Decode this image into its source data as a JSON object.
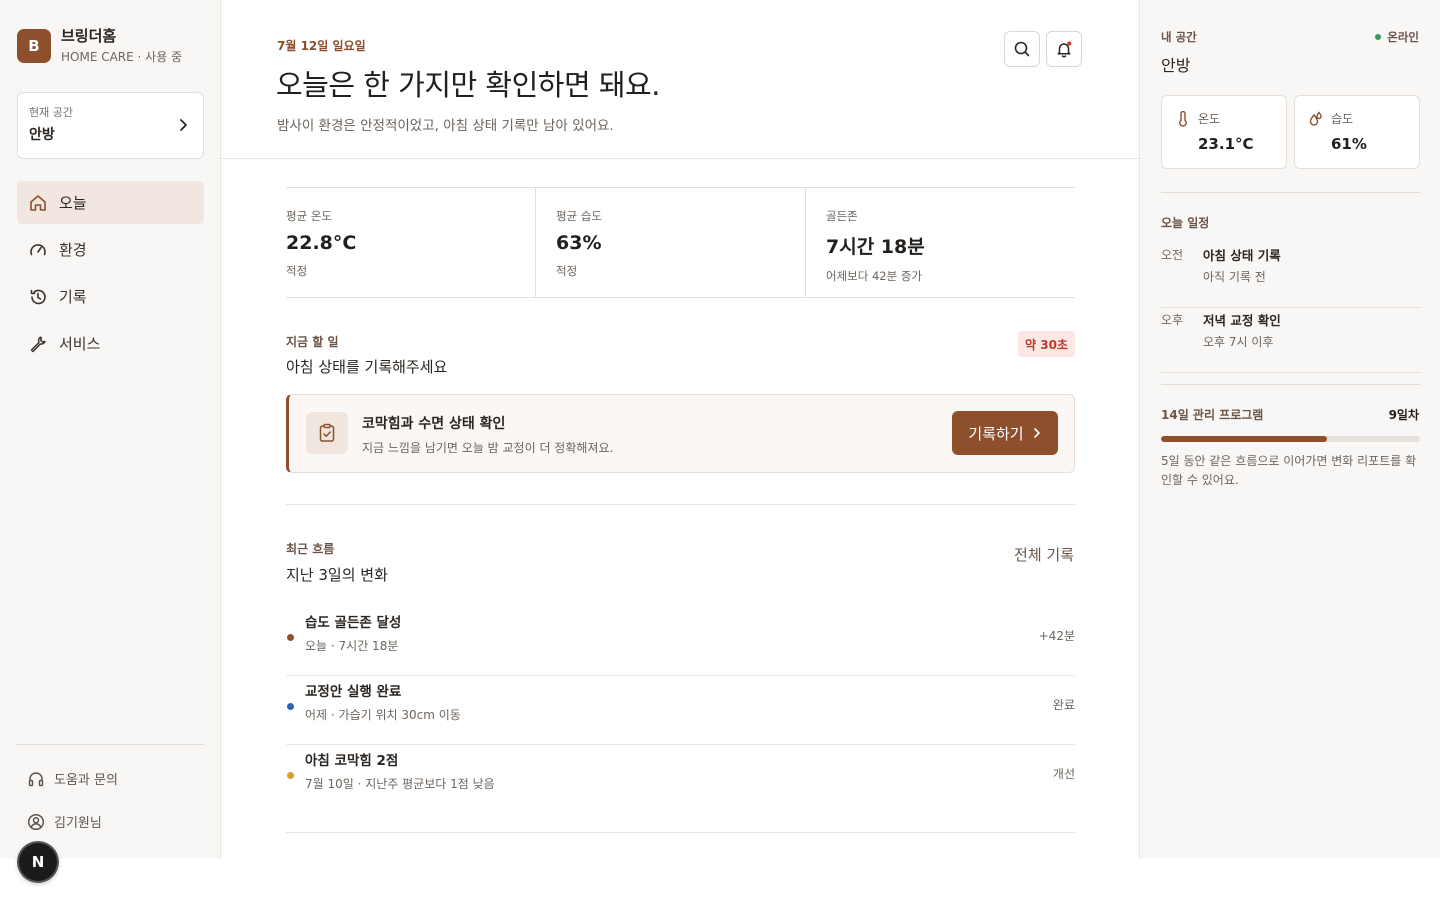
{
  "brand": {
    "logo_letter": "B",
    "name": "브링더홈",
    "subtitle": "HOME CARE · 사용 중"
  },
  "space_selector": {
    "label": "현재 공간",
    "value": "안방"
  },
  "nav": [
    {
      "label": "오늘",
      "icon": "home-icon",
      "active": true
    },
    {
      "label": "환경",
      "icon": "gauge-icon",
      "active": false
    },
    {
      "label": "기록",
      "icon": "history-icon",
      "active": false
    },
    {
      "label": "서비스",
      "icon": "wrench-icon",
      "active": false
    }
  ],
  "sidebar_footer": {
    "help": "도움과 문의",
    "user": "김기원님",
    "badge": "N"
  },
  "header": {
    "date": "7월 12일 일요일",
    "title": "오늘은 한 가지만 확인하면 돼요.",
    "subtitle": "밤사이 환경은 안정적이었고, 아침 상태 기록만 남아 있어요."
  },
  "stats": [
    {
      "label": "평균 온도",
      "value": "22.8°C",
      "note": "적정"
    },
    {
      "label": "평균 습도",
      "value": "63%",
      "note": "적정"
    },
    {
      "label": "골든존",
      "value": "7시간 18분",
      "note": "어제보다 42분 증가"
    }
  ],
  "todo": {
    "eyebrow": "지금 할 일",
    "title": "아침 상태를 기록해주세요",
    "time_chip": "약 30초",
    "card_title": "코막힘과 수면 상태 확인",
    "card_sub": "지금 느낌을 남기면 오늘 밤 교정이 더 정확해져요.",
    "button": "기록하기"
  },
  "recent": {
    "eyebrow": "최근 흐름",
    "title": "지난 3일의 변화",
    "all_link": "전체 기록",
    "items": [
      {
        "title": "습도 골든존 달성",
        "sub": "오늘 · 7시간 18분",
        "right": "+42분",
        "color": "#8d4f2c"
      },
      {
        "title": "교정안 실행 완료",
        "sub": "어제 · 가습기 위치 30cm 이동",
        "right": "완료",
        "color": "#2f5fb8"
      },
      {
        "title": "아침 코막힘 2점",
        "sub": "7월 10일 · 지난주 평균보다 1점 낮음",
        "right": "개선",
        "color": "#d9a22c"
      }
    ]
  },
  "right_panel": {
    "eyebrow": "내 공간",
    "online": "온라인",
    "room": "안방",
    "temp_label": "온도",
    "temp_value": "23.1°C",
    "humid_label": "습도",
    "humid_value": "61%",
    "schedule_title": "오늘 일정",
    "schedule": [
      {
        "when": "오전",
        "what": "아침 상태 기록",
        "status": "아직 기록 전"
      },
      {
        "when": "오후",
        "what": "저녁 교정 확인",
        "status": "오후 7시 이후"
      }
    ],
    "program_title": "14일 관리 프로그램",
    "program_day": "9일차",
    "program_progress": 0.64,
    "program_note": "5일 동안 같은 흐름으로 이어가면 변화 리포트를 확인할 수 있어요."
  },
  "colors": {
    "accent": "#8d4f2c",
    "online": "#2f9e59",
    "chip_text": "#c0392b"
  }
}
